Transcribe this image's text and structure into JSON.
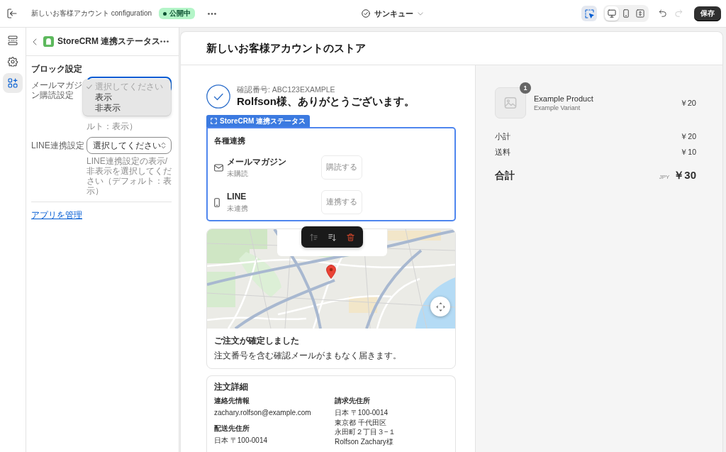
{
  "top_bar": {
    "title": "新しいお客様アカウント configuration",
    "status": {
      "label": "公開中",
      "published": true
    },
    "template": "サンキュー",
    "inspector": {
      "selected": true
    },
    "devices": [
      {
        "kind": "desktop",
        "selected": true
      },
      {
        "kind": "mobile",
        "selected": false
      },
      {
        "kind": "fullwidth",
        "selected": false
      }
    ],
    "undo": {
      "disabled": false
    },
    "redo": {
      "disabled": true
    },
    "save": "保存"
  },
  "rail": [
    {
      "kind": "sections",
      "selected": false
    },
    {
      "kind": "settings",
      "selected": false
    },
    {
      "kind": "apps",
      "selected": true
    }
  ],
  "panel": {
    "title": "StoreCRM 連携ステータス",
    "section": "ブロック設定",
    "fields": [
      {
        "label": "メールマガジン購読設定",
        "open": true,
        "help": "ルト：表示）",
        "options": [
          {
            "label": "選択してください",
            "checked": true,
            "disabled": true
          },
          {
            "label": "表示",
            "checked": false,
            "disabled": false
          },
          {
            "label": "非表示",
            "checked": false,
            "disabled": false
          }
        ]
      },
      {
        "label": "LINE連携設定",
        "open": false,
        "value": "選択してください",
        "help": "LINE連携設定の表示/非表示を選択してください（デフォルト：表示）"
      }
    ],
    "link": "アプリを管理"
  },
  "preview": {
    "store_name": "新しいお客様アカウントのストア",
    "confirmation": "確認番号: ABC123EXAMPLE",
    "thanks": "Rolfson様、ありがとうございます。",
    "block": {
      "tag": "StoreCRM 連携ステータス",
      "selected": true,
      "title": "各種連携",
      "rows": [
        {
          "kind": "mail",
          "name": "メールマガジン",
          "status": "未購読",
          "action": "購読する"
        },
        {
          "kind": "phone",
          "name": "LINE",
          "status": "未連携",
          "action": "連携する"
        }
      ],
      "toolbar": [
        {
          "kind": "move_up",
          "disabled": true
        },
        {
          "kind": "move_down",
          "disabled": false
        },
        {
          "kind": "delete",
          "disabled": false
        }
      ]
    },
    "confirmed": {
      "title": "ご注文が確定しました",
      "text": "注文番号を含む確認メールがまもなく届きます。"
    },
    "details": {
      "title": "注文詳細",
      "contact": {
        "heading": "連絡先情報",
        "lines": [
          "zachary.rolfson@example.com"
        ]
      },
      "shipping": {
        "heading": "配送先住所",
        "lines": [
          "日本 〒100-0014"
        ]
      },
      "billing": {
        "heading": "請求先住所",
        "lines": [
          "日本 〒100-0014",
          "東京都 千代田区",
          "永田町２丁目３−１",
          "Rolfson Zachary様"
        ]
      }
    }
  },
  "summary": {
    "items": [
      {
        "name": "Example Product",
        "variant": "Example Variant",
        "quantity": "1",
        "price": "￥20"
      }
    ],
    "lines": [
      {
        "label": "小計",
        "amount": "￥20"
      },
      {
        "label": "送料",
        "amount": "￥10"
      }
    ],
    "total": {
      "label": "合計",
      "currency": "JPY",
      "amount": "￥30"
    }
  }
}
